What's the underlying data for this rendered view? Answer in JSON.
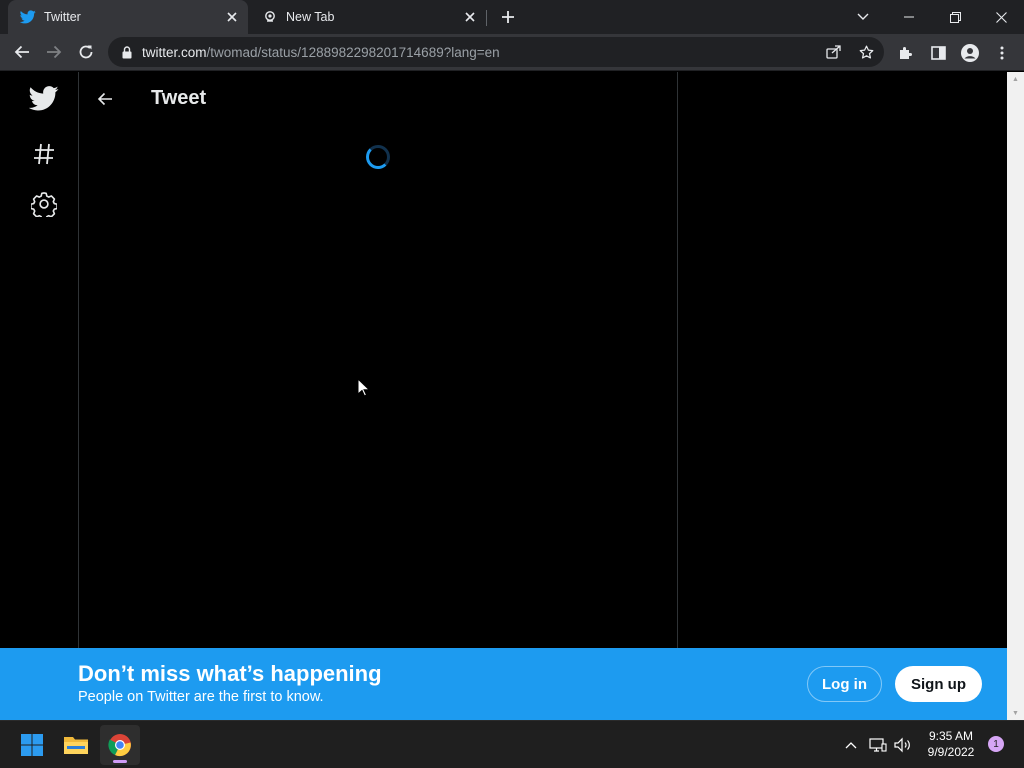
{
  "browser": {
    "tabs": [
      {
        "title": "Twitter",
        "icon": "twitter-bird-icon",
        "active": true
      },
      {
        "title": "New Tab",
        "icon": "new-tab-globe-icon",
        "active": false
      }
    ],
    "address_bar": {
      "host": "twitter.com",
      "path": "/twomad/status/1288982298201714689?lang=en"
    }
  },
  "page": {
    "nav_icons": [
      "twitter-bird-icon",
      "hashtag-icon",
      "settings-gear-icon"
    ],
    "header_title": "Tweet",
    "loading": true
  },
  "banner": {
    "headline": "Don’t miss what’s happening",
    "subtext": "People on Twitter are the first to know.",
    "login_label": "Log in",
    "signup_label": "Sign up"
  },
  "taskbar": {
    "apps": [
      "windows-start-icon",
      "file-explorer-icon",
      "chrome-icon"
    ],
    "time": "9:35 AM",
    "date": "9/9/2022",
    "notification_count": "1"
  },
  "colors": {
    "twitter_blue": "#1d9bf0",
    "page_background": "#000000",
    "chrome_dark": "#202124",
    "chrome_toolbar": "#35363a"
  }
}
